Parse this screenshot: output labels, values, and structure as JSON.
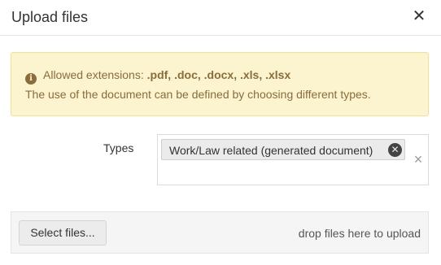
{
  "dialog": {
    "title": "Upload files",
    "close_icon": "close-icon",
    "close_glyph": "✕"
  },
  "alert": {
    "icon": "info-icon",
    "icon_glyph": "i",
    "prefix": "Allowed extensions: ",
    "extensions": ".pdf, .doc, .docx, .xls, .xlsx",
    "description": "The use of the document can be defined by choosing different types.",
    "color": "#8a6d3b",
    "background": "#fcf3cf"
  },
  "types": {
    "label": "Types",
    "selected": [
      {
        "label": "Work/Law related (generated document)",
        "remove_glyph": "✕"
      }
    ],
    "clear_glyph": "×"
  },
  "upload": {
    "select_button": "Select files...",
    "drop_hint": "drop files here to upload"
  }
}
